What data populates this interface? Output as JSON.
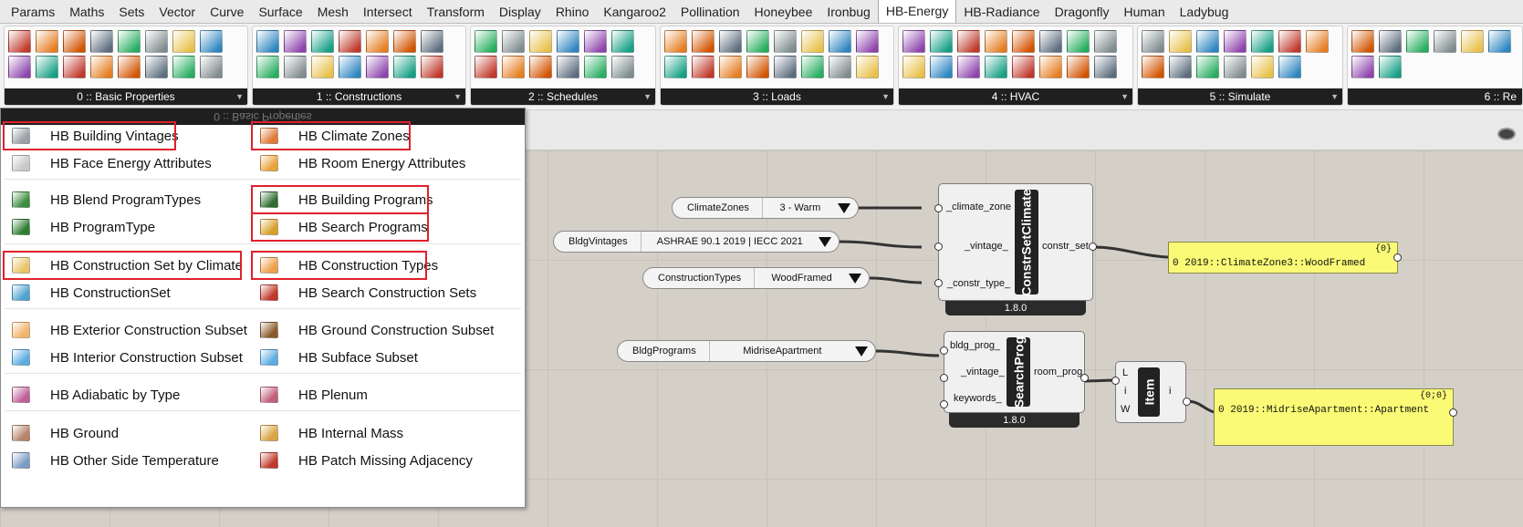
{
  "tabs": [
    "Params",
    "Maths",
    "Sets",
    "Vector",
    "Curve",
    "Surface",
    "Mesh",
    "Intersect",
    "Transform",
    "Display",
    "Rhino",
    "Kangaroo2",
    "Pollination",
    "Honeybee",
    "Ironbug",
    "HB-Energy",
    "HB-Radiance",
    "Dragonfly",
    "Human",
    "Ladybug"
  ],
  "active_tab": "HB-Energy",
  "ribbon_panels": [
    {
      "label": "0 :: Basic Properties"
    },
    {
      "label": "1 :: Constructions"
    },
    {
      "label": "2 :: Schedules"
    },
    {
      "label": "3 :: Loads"
    },
    {
      "label": "4 :: HVAC"
    },
    {
      "label": "5 :: Simulate"
    },
    {
      "label": "6 :: Re"
    }
  ],
  "menu": {
    "header": "0 :: Basic Properties",
    "items": [
      {
        "label": "HB Building Vintages",
        "icon": "building-vintages-icon",
        "highlighted": true
      },
      {
        "label": "HB Climate Zones",
        "icon": "climate-zones-icon",
        "highlighted": true
      },
      {
        "label": "HB Face Energy Attributes",
        "icon": "face-attr-icon",
        "highlighted": false
      },
      {
        "label": "HB Room Energy Attributes",
        "icon": "room-attr-icon",
        "highlighted": false
      },
      {
        "label": "HB Blend ProgramTypes",
        "icon": "blend-program-icon",
        "highlighted": false
      },
      {
        "label": "HB Building Programs",
        "icon": "building-programs-icon",
        "highlighted": true
      },
      {
        "label": "HB ProgramType",
        "icon": "program-type-icon",
        "highlighted": false
      },
      {
        "label": "HB Search Programs",
        "icon": "search-programs-icon",
        "highlighted": true
      },
      {
        "label": "HB Construction Set by Climate",
        "icon": "construction-set-climate-icon",
        "highlighted": true
      },
      {
        "label": "HB Construction Types",
        "icon": "construction-types-icon",
        "highlighted": true
      },
      {
        "label": "HB ConstructionSet",
        "icon": "construction-set-icon",
        "highlighted": false
      },
      {
        "label": "HB Search Construction Sets",
        "icon": "search-construction-sets-icon",
        "highlighted": false
      },
      {
        "label": "HB Exterior Construction Subset",
        "icon": "exterior-subset-icon",
        "highlighted": false
      },
      {
        "label": "HB Ground Construction Subset",
        "icon": "ground-subset-icon",
        "highlighted": false
      },
      {
        "label": "HB Interior Construction Subset",
        "icon": "interior-subset-icon",
        "highlighted": false
      },
      {
        "label": "HB Subface Subset",
        "icon": "subface-subset-icon",
        "highlighted": false
      },
      {
        "label": "HB Adiabatic by Type",
        "icon": "adiabatic-icon",
        "highlighted": false
      },
      {
        "label": "HB Plenum",
        "icon": "plenum-icon",
        "highlighted": false
      },
      {
        "label": "HB Ground",
        "icon": "ground-icon",
        "highlighted": false
      },
      {
        "label": "HB Internal Mass",
        "icon": "internal-mass-icon",
        "highlighted": false
      },
      {
        "label": "HB Other Side Temperature",
        "icon": "other-side-temp-icon",
        "highlighted": false
      },
      {
        "label": "HB Patch Missing Adjacency",
        "icon": "patch-adjacency-icon",
        "highlighted": false
      }
    ]
  },
  "value_lists": [
    {
      "name": "ClimateZones",
      "value": "3 - Warm"
    },
    {
      "name": "BldgVintages",
      "value": "ASHRAE 90.1 2019 | IECC 2021"
    },
    {
      "name": "ConstructionTypes",
      "value": "WoodFramed"
    },
    {
      "name": "BldgPrograms",
      "value": "MidriseApartment"
    }
  ],
  "components": {
    "constr_set_climate": {
      "title": "ConstrSetClimate",
      "inputs": [
        "_climate_zone",
        "_vintage_",
        "_constr_type_"
      ],
      "output": "constr_set",
      "version": "1.8.0"
    },
    "search_prog": {
      "title": "SearchProg",
      "inputs": [
        "bldg_prog_",
        "_vintage_",
        "keywords_"
      ],
      "output": "room_prog",
      "version": "1.8.0"
    },
    "list_item": {
      "title": "Item",
      "inputs": [
        "L",
        "i",
        "W"
      ],
      "output": "i"
    }
  },
  "panels": [
    {
      "path": "{0}",
      "index": "0",
      "value": "2019::ClimateZone3::WoodFramed"
    },
    {
      "path": "{0;0}",
      "index": "0",
      "value": "2019::MidriseApartment::Apartment"
    }
  ],
  "colors": {
    "highlight": "#e0202a",
    "panel_yellow": "#fafa76",
    "ribbon_label_bg": "#1f1f1f"
  }
}
